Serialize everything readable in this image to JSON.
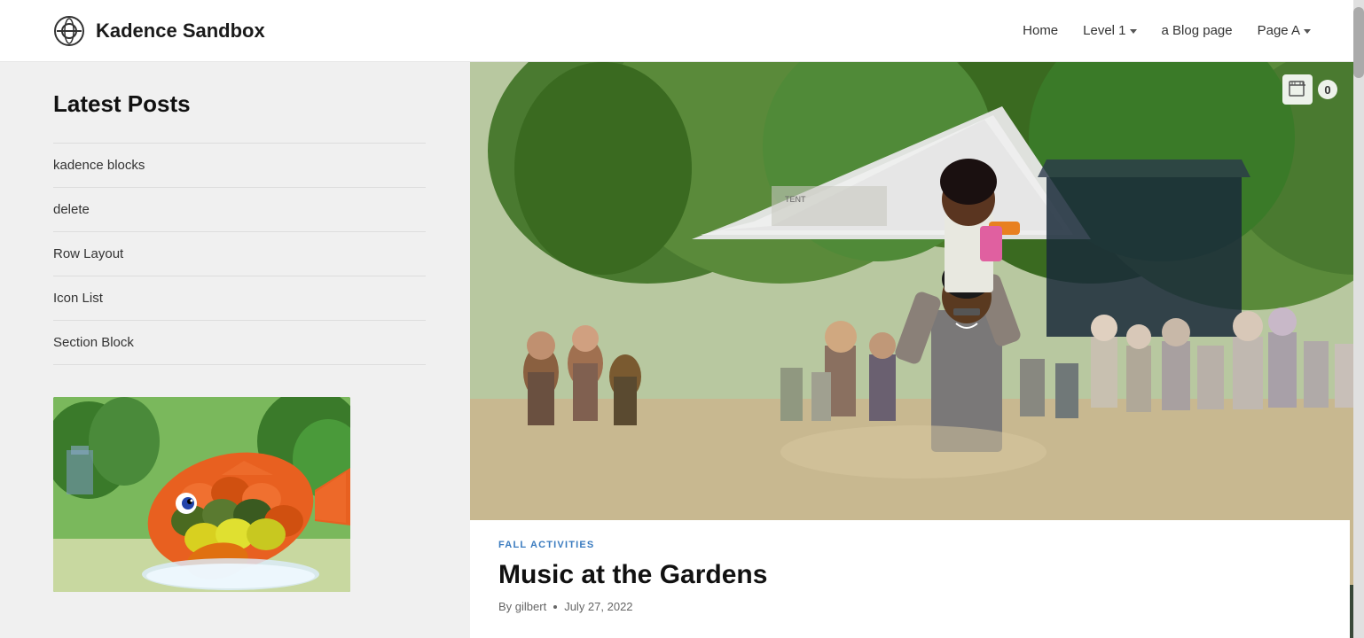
{
  "header": {
    "logo_alt": "logoipsum logo",
    "site_title": "Kadence Sandbox",
    "nav_items": [
      {
        "label": "Home",
        "has_dropdown": false
      },
      {
        "label": "Level 1",
        "has_dropdown": true
      },
      {
        "label": "a Blog page",
        "has_dropdown": false
      },
      {
        "label": "Page A",
        "has_dropdown": true
      }
    ]
  },
  "sidebar": {
    "title": "Latest Posts",
    "posts": [
      {
        "label": "kadence blocks"
      },
      {
        "label": "delete"
      },
      {
        "label": "Row Layout"
      },
      {
        "label": "Icon List"
      },
      {
        "label": "Section Block"
      }
    ]
  },
  "article": {
    "category": "FALL ACTIVITIES",
    "title": "Music at the Gardens",
    "meta_by": "By gilbert",
    "meta_dot": "•",
    "meta_date": "July 27, 2022"
  },
  "cart": {
    "count": "0"
  },
  "icons": {
    "cart": "🛒",
    "logo": "⊙"
  }
}
